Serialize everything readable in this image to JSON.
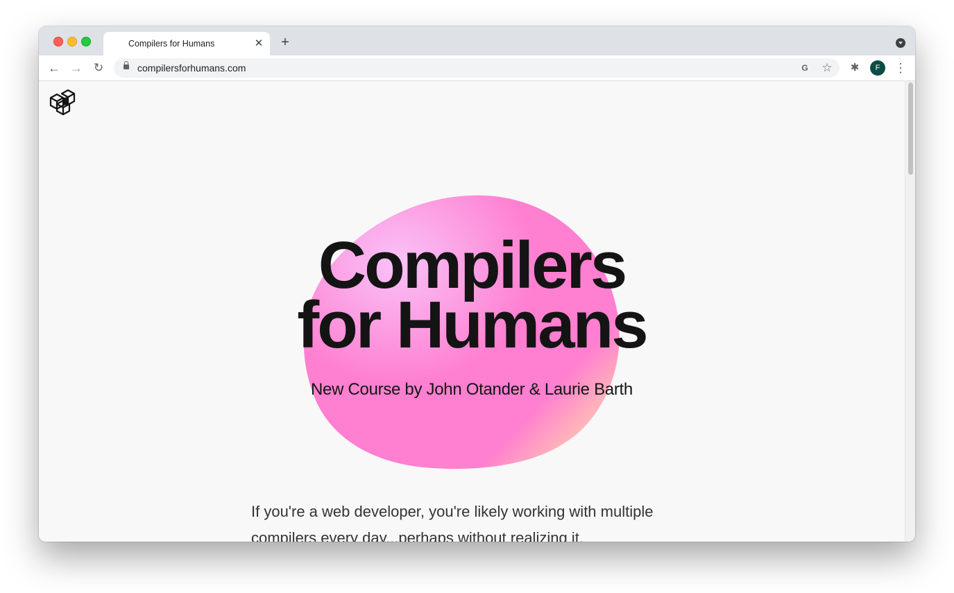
{
  "browser": {
    "tab_title": "Compilers for Humans",
    "tab_close": "✕",
    "new_tab": "+",
    "url": "compilersforhumans.com",
    "back_glyph": "←",
    "forward_glyph": "→",
    "reload_glyph": "↻",
    "translate_glyph": "G",
    "star_glyph": "☆",
    "extensions_glyph": "✱",
    "profile_initial": "F",
    "menu_glyph": "⋮",
    "profile_color": "#0b4d45"
  },
  "page": {
    "logo_icon": "cube-stack-icon",
    "hero": {
      "title_line1": "Compilers",
      "title_line2": "for Humans",
      "subtitle": "New Course by John Otander & Laurie Barth",
      "blob_colors": [
        "#f9c2f8",
        "#ff7fd0",
        "#ffe1a6"
      ]
    },
    "intro_text": "If you're a web developer, you're likely working with multiple compilers every day...perhaps without realizing it."
  }
}
